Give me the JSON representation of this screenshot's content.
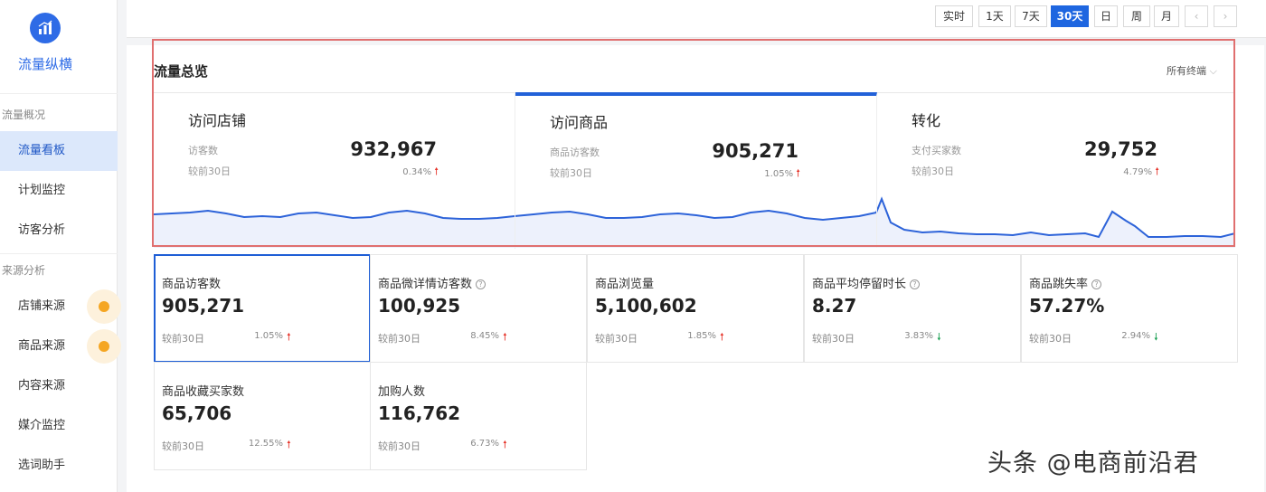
{
  "app": {
    "name": "流量纵横"
  },
  "sidebar": {
    "groups": [
      {
        "label": "流量概况",
        "items": [
          "流量看板",
          "计划监控",
          "访客分析"
        ]
      },
      {
        "label": "来源分析",
        "items": [
          "店铺来源",
          "商品来源",
          "内容来源",
          "媒介监控",
          "选词助手"
        ]
      }
    ],
    "active_item": "流量看板"
  },
  "time_range": {
    "options": [
      "实时",
      "1天",
      "7天",
      "30天",
      "日",
      "周",
      "月"
    ],
    "selected": "30天",
    "prev_icon": "chevron-left-icon",
    "next_icon": "chevron-right-icon"
  },
  "overview": {
    "title": "流量总览",
    "filter": "所有终端",
    "cards": [
      {
        "title": "访问店铺",
        "label": "访客数",
        "value": "932,967",
        "compare": "较前30日",
        "change": "0.34%",
        "trend": "up"
      },
      {
        "title": "访问商品",
        "label": "商品访客数",
        "value": "905,271",
        "compare": "较前30日",
        "change": "1.05%",
        "trend": "up"
      },
      {
        "title": "转化",
        "label": "支付买家数",
        "value": "29,752",
        "compare": "较前30日",
        "change": "4.79%",
        "trend": "up"
      }
    ]
  },
  "metrics": [
    {
      "label": "商品访客数",
      "value": "905,271",
      "compare": "较前30日",
      "change": "1.05%",
      "trend": "up",
      "help": false
    },
    {
      "label": "商品微详情访客数",
      "value": "100,925",
      "compare": "较前30日",
      "change": "8.45%",
      "trend": "up",
      "help": true
    },
    {
      "label": "商品浏览量",
      "value": "5,100,602",
      "compare": "较前30日",
      "change": "1.85%",
      "trend": "up",
      "help": false
    },
    {
      "label": "商品平均停留时长",
      "value": "8.27",
      "compare": "较前30日",
      "change": "3.83%",
      "trend": "down",
      "help": true
    },
    {
      "label": "商品跳失率",
      "value": "57.27%",
      "compare": "较前30日",
      "change": "2.94%",
      "trend": "down",
      "help": true
    },
    {
      "label": "商品收藏买家数",
      "value": "65,706",
      "compare": "较前30日",
      "change": "12.55%",
      "trend": "up",
      "help": false
    },
    {
      "label": "加购人数",
      "value": "116,762",
      "compare": "较前30日",
      "change": "6.73%",
      "trend": "up",
      "help": false
    }
  ],
  "watermark": "头条 @电商前沿君",
  "colors": {
    "accent": "#1e66e0",
    "up": "#e6342a",
    "down": "#1aa053",
    "highlight": "#e06f6f",
    "active_bg": "#dce8fb"
  }
}
